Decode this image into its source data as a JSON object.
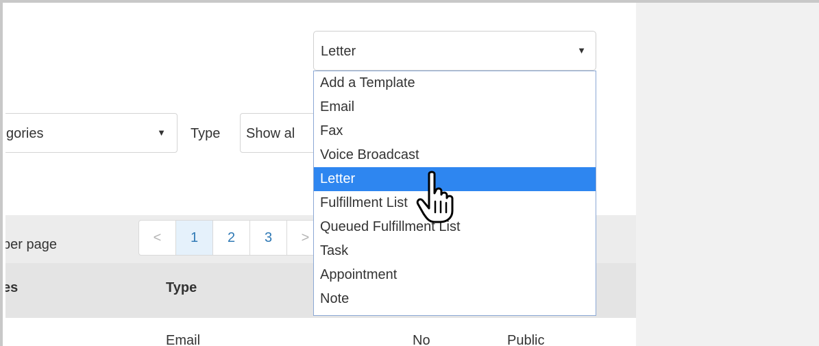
{
  "filters": {
    "category_value": "gories",
    "type_label": "Type",
    "type_value": "Show al"
  },
  "template_select": {
    "value": "Letter",
    "options": [
      "Add a Template",
      "Email",
      "Fax",
      "Voice Broadcast",
      "Letter",
      "Fulfillment List",
      "Queued Fulfillment List",
      "Task",
      "Appointment",
      "Note"
    ],
    "selected_index": 4
  },
  "pagination": {
    "per_page_text": "per page",
    "prev": "<",
    "pages": [
      "1",
      "2",
      "3"
    ],
    "next": ">",
    "active": "1"
  },
  "table": {
    "headers": [
      "es",
      "Type"
    ],
    "row": [
      "Email",
      "No",
      "Public"
    ]
  },
  "colors": {
    "selected_bg": "#2e86f0",
    "link": "#2f79b5",
    "right_panel": "#f1f1f1"
  }
}
